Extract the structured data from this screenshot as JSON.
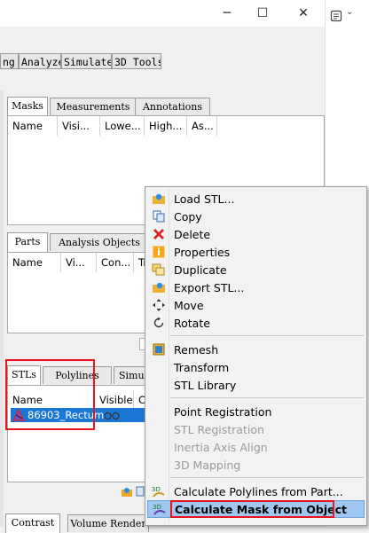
{
  "window": {
    "minimize_glyph": "─",
    "maximize_glyph": "☐",
    "close_glyph": "✕"
  },
  "toolbar_tabs": [
    "ng",
    "Analyze",
    "Simulate",
    "3D Tools"
  ],
  "extension": {
    "icon": "document-list-icon",
    "chevron": "⌄"
  },
  "masks_panel": {
    "tabs": [
      "Masks",
      "Measurements",
      "Annotations"
    ],
    "columns": [
      "Name",
      "Visi...",
      "Lowe...",
      "High...",
      "As..."
    ]
  },
  "parts_panel": {
    "tabs": [
      "Parts",
      "Analysis Objects"
    ],
    "columns": [
      "Name",
      "Vi...",
      "Con...",
      "Tr"
    ]
  },
  "stls_panel": {
    "tabs": [
      "STLs",
      "Polylines",
      "Simul"
    ],
    "columns": [
      "Name",
      "Visible",
      "C"
    ],
    "rows": [
      {
        "name": "86903_Rectum",
        "icon": "stl-triangle-icon",
        "visible_icon": "glasses-icon"
      }
    ]
  },
  "bottom_tabs": [
    "Contrast",
    "Volume Render"
  ],
  "context_menu": {
    "items": [
      {
        "label": "Load STL...",
        "icon": "folder-open-icon",
        "enabled": true
      },
      {
        "label": "Copy",
        "icon": "copy-icon",
        "enabled": true
      },
      {
        "label": "Delete",
        "icon": "delete-x-icon",
        "enabled": true
      },
      {
        "label": "Properties",
        "icon": "info-icon",
        "enabled": true
      },
      {
        "label": "Duplicate",
        "icon": "duplicate-icon",
        "enabled": true
      },
      {
        "label": "Export STL...",
        "icon": "export-folder-icon",
        "enabled": true
      },
      {
        "label": "Move",
        "icon": "move-arrows-icon",
        "enabled": true
      },
      {
        "label": "Rotate",
        "icon": "rotate-icon",
        "enabled": true
      },
      {
        "label": "Remesh",
        "icon": "remesh-cube-icon",
        "enabled": true
      },
      {
        "label": "Transform",
        "icon": "",
        "enabled": true
      },
      {
        "label": "STL Library",
        "icon": "",
        "enabled": true
      },
      {
        "label": "Point Registration",
        "icon": "",
        "enabled": true
      },
      {
        "label": "STL Registration",
        "icon": "",
        "enabled": false
      },
      {
        "label": "Inertia Axis Align",
        "icon": "",
        "enabled": false
      },
      {
        "label": "3D Mapping",
        "icon": "",
        "enabled": false
      },
      {
        "label": "Calculate Polylines from Part...",
        "icon": "calc-3d-icon",
        "enabled": true
      },
      {
        "label": "Calculate Mask from Object",
        "icon": "calc-3d-icon",
        "enabled": true,
        "hovered": true
      }
    ]
  },
  "colors": {
    "selection": "#1a78d4",
    "highlight_box": "#e8141d",
    "menu_hover": "#9fc7ef"
  }
}
